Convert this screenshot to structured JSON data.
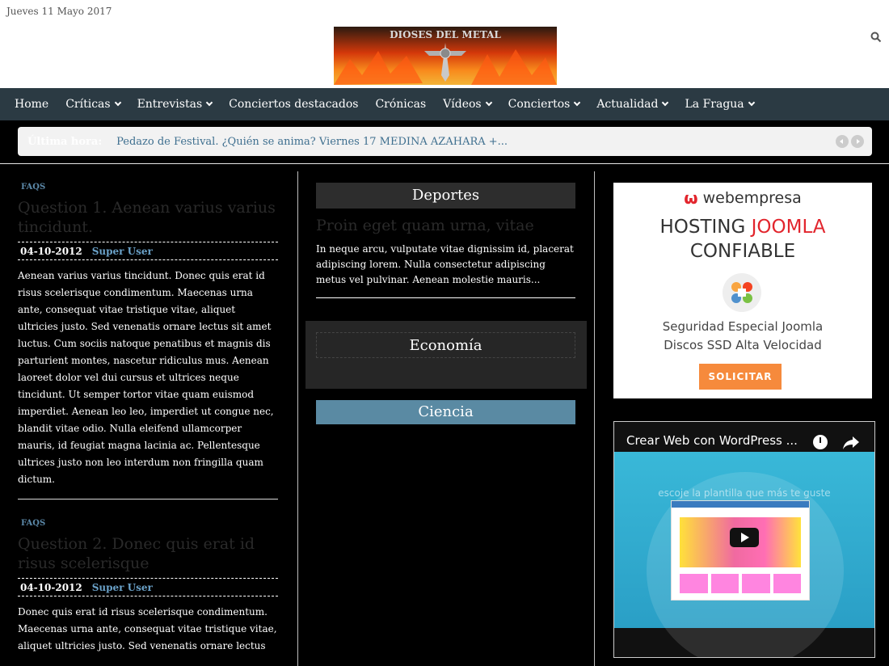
{
  "header": {
    "date": "Jueves 11 Mayo 2017",
    "logo_text": "DIOSES DEL METAL"
  },
  "nav": {
    "items": [
      {
        "label": "Home",
        "dropdown": false
      },
      {
        "label": "Críticas",
        "dropdown": true
      },
      {
        "label": "Entrevistas",
        "dropdown": true
      },
      {
        "label": "Conciertos destacados",
        "dropdown": false
      },
      {
        "label": "Crónicas",
        "dropdown": false
      },
      {
        "label": "Vídeos",
        "dropdown": true
      },
      {
        "label": "Conciertos",
        "dropdown": true
      },
      {
        "label": "Actualidad",
        "dropdown": true
      },
      {
        "label": "La Fragua",
        "dropdown": true
      }
    ]
  },
  "ticker": {
    "label": "Última hora:",
    "text": "Pedazo de Festival. ¿Quién se anima? Viernes 17 MEDINA AZAHARA +..."
  },
  "left": {
    "articles": [
      {
        "category": "FAQS",
        "title": "Question 1. Aenean varius varius tincidunt.",
        "date": "04-10-2012",
        "author": "Super User",
        "body": "Aenean varius varius tincidunt. Donec quis erat id risus scelerisque condimentum. Maecenas urna ante, consequat vitae tristique vitae, aliquet ultricies justo. Sed venenatis ornare lectus sit amet luctus. Cum sociis natoque penatibus et magnis dis parturient montes, nascetur ridiculus mus. Aenean laoreet dolor vel dui cursus et ultrices neque tincidunt. Ut semper tortor vitae quam euismod imperdiet. Aenean leo leo, imperdiet ut congue nec, blandit vitae odio. Nulla eleifend ullamcorper mauris, id feugiat magna lacinia ac. Pellentesque ultrices justo non leo interdum non fringilla quam dictum."
      },
      {
        "category": "FAQS",
        "title": "Question 2. Donec quis erat id risus scelerisque",
        "date": "04-10-2012",
        "author": "Super User",
        "body": "Donec quis erat id risus scelerisque condimentum. Maecenas urna ante, consequat vitae tristique vitae, aliquet ultricies justo. Sed venenatis ornare lectus"
      }
    ]
  },
  "middle": {
    "deportes": {
      "heading": "Deportes",
      "title": "Proin eget quam urna, vitae",
      "body": "In neque arcu, vulputate vitae dignissim id, placerat adipiscing lorem. Nulla consectetur adipiscing metus vel pulvinar. Aenean molestie mauris..."
    },
    "economia": {
      "heading": "Economía"
    },
    "ciencia": {
      "heading": "Ciencia"
    }
  },
  "ad": {
    "brand": "webempresa",
    "headline_1": "HOSTING",
    "headline_2": "JOOMLA",
    "headline_3": "CONFIABLE",
    "line_1": "Seguridad Especial Joomla",
    "line_2": "Discos SSD Alta Velocidad",
    "button": "SOLICITAR",
    "colors": {
      "red": "#e2252d",
      "button": "#f68a3c"
    }
  },
  "video": {
    "title": "Crear Web con WordPress ...",
    "caption": "escoje la plantilla que más te guste"
  },
  "colors": {
    "nav_bg": "#2b3a43",
    "link": "#5b88a8",
    "ciencia": "#5a8aa3"
  }
}
